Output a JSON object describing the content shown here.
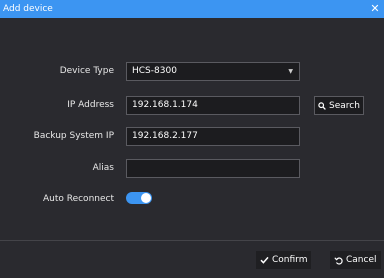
{
  "dialog": {
    "title": "Add device",
    "close_icon": "close-icon"
  },
  "form": {
    "device_type": {
      "label": "Device Type",
      "value": "HCS-8300"
    },
    "ip_address": {
      "label": "IP Address",
      "value": "192.168.1.174"
    },
    "backup_ip": {
      "label": "Backup System IP",
      "value": "192.168.2.177"
    },
    "alias": {
      "label": "Alias",
      "value": ""
    },
    "auto_reconnect": {
      "label": "Auto Reconnect",
      "enabled": true
    }
  },
  "buttons": {
    "search": "Search",
    "confirm": "Confirm",
    "cancel": "Cancel"
  },
  "colors": {
    "accent": "#3c95f2",
    "background": "#2a2a2f"
  }
}
